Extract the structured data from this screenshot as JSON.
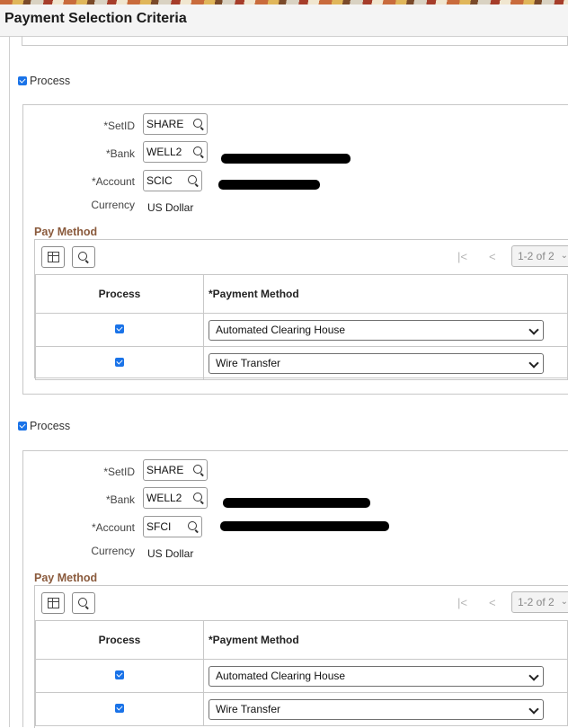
{
  "header": {
    "title": "Payment Selection Criteria"
  },
  "sections": [
    {
      "process_label": "Process",
      "setid": {
        "label": "*SetID",
        "value": "SHARE"
      },
      "bank": {
        "label": "*Bank",
        "value": "WELL2"
      },
      "account": {
        "label": "*Account",
        "value": "SCIC"
      },
      "currency": {
        "label": "Currency",
        "value": "US Dollar"
      },
      "pay_method": {
        "title": "Pay Method",
        "pager": "1-2 of 2",
        "columns": [
          "Process",
          "*Payment Method"
        ],
        "rows": [
          {
            "checked": true,
            "method": "Automated Clearing House"
          },
          {
            "checked": true,
            "method": "Wire Transfer"
          }
        ]
      }
    },
    {
      "process_label": "Process",
      "setid": {
        "label": "*SetID",
        "value": "SHARE"
      },
      "bank": {
        "label": "*Bank",
        "value": "WELL2"
      },
      "account": {
        "label": "*Account",
        "value": "SFCI"
      },
      "currency": {
        "label": "Currency",
        "value": "US Dollar"
      },
      "pay_method": {
        "title": "Pay Method",
        "pager": "1-2 of 2",
        "columns": [
          "Process",
          "*Payment Method"
        ],
        "rows": [
          {
            "checked": true,
            "method": "Automated Clearing House"
          },
          {
            "checked": true,
            "method": "Wire Transfer"
          }
        ]
      }
    }
  ],
  "colors": {
    "accent": "#1a73e8",
    "section_title": "#8a5a3c"
  }
}
